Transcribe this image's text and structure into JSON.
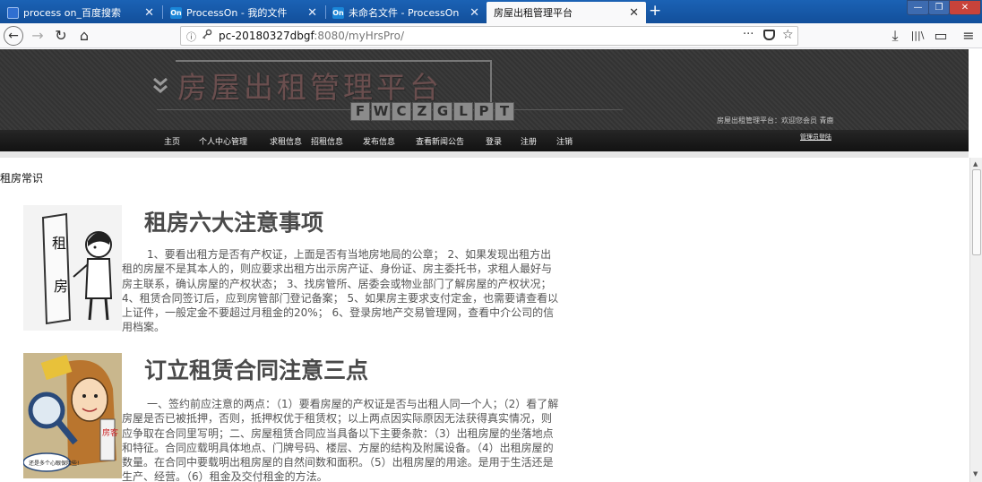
{
  "browser": {
    "tabs": [
      {
        "title": "process on_百度搜索",
        "icon": "baidu-icon",
        "active": false
      },
      {
        "title": "ProcessOn - 我的文件",
        "icon": "processon-icon",
        "active": false
      },
      {
        "title": "未命名文件 - ProcessOn",
        "icon": "processon-icon",
        "active": false
      },
      {
        "title": "房屋出租管理平台",
        "icon": "",
        "active": true
      }
    ],
    "favicon_text": {
      "processon": "On"
    },
    "close_glyph": "✕",
    "new_tab_glyph": "+",
    "url_host": "pc-20180327dbgf",
    "url_rest": ":8080/myHrsPro/",
    "more_glyph": "···",
    "star_glyph": "☆",
    "back_glyph": "←",
    "forward_glyph": "→",
    "reload_glyph": "↻",
    "home_glyph": "⌂",
    "download_glyph": "⤓",
    "library_glyph": "|||\\",
    "sidebar_glyph": "▭",
    "menu_glyph": "≡",
    "info_glyph": "ⓘ",
    "key_glyph": "🔑",
    "window_controls": [
      "—",
      "❐",
      "✕"
    ]
  },
  "site": {
    "logo_title": "房屋出租管理平台",
    "logo_letters": [
      "F",
      "W",
      "C",
      "Z",
      "G",
      "L",
      "P",
      "T"
    ],
    "chevron_glyph": "»",
    "welcome": "房屋出租管理平台：欢迎您会员 青鹿",
    "nav": [
      "主页",
      "个人中心管理",
      "求租信息",
      "招租信息",
      "发布信息",
      "查看新闻公告",
      "登录",
      "注册",
      "注销"
    ],
    "admin_link": "管理员登陆"
  },
  "content": {
    "section_title": "租房常识",
    "articles": [
      {
        "title": "租房六大注意事项",
        "image": "renting-cartoon",
        "image_text": [
          "租",
          "房"
        ],
        "body": "1、要看出租方是否有产权证，上面是否有当地房地局的公章； 2、如果发现出租方出租的房屋不是其本人的，则应要求出租方出示房产证、身份证、房主委托书，求租人最好与房主联系，确认房屋的产权状态； 3、找房管所、居委会或物业部门了解房屋的产权状况； 4、租赁合同签订后，应到房管部门登记备案； 5、如果房主要求支付定金，也需要请查看以上证件，一般定金不要超过月租金的20%； 6、登录房地产交易管理网，查看中介公司的信用档案。"
      },
      {
        "title": "订立租赁合同注意三点",
        "image": "contract-cartoon",
        "image_text": [
          "房客",
          "还是多个心眼保险些!"
        ],
        "body": "一、签约前应注意的两点：（1）要看房屋的产权证是否与出租人同一个人；（2）看了解房屋是否已被抵押，否则，抵押权优于租赁权；以上两点因实际原因无法获得真实情况，则应争取在合同里写明；二、房屋租赁合同应当具备以下主要条款：（3）出租房屋的坐落地点和特征。合同应载明具体地点、门牌号码、楼层、方屋的结构及附属设备。（4）出租房屋的数量。在合同中要载明出租房屋的自然间数和面积。（5）出租房屋的用途。是用于生活还是生产、经营。（6）租金及交付租金的方法。"
      }
    ]
  },
  "colors": {
    "tabstrip": "#1b62b5",
    "header_bg": "#363636",
    "nav_bg": "#1c1c1c",
    "heading": "#4a4a4a",
    "body_text": "#555555"
  }
}
